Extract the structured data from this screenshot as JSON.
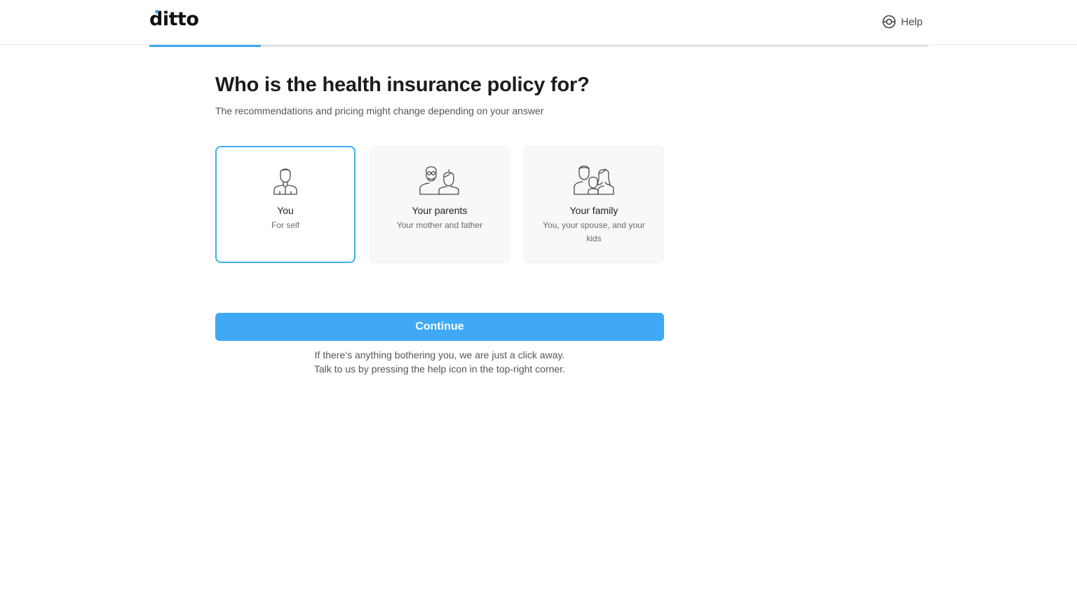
{
  "header": {
    "logo_text": "ditto",
    "help_label": "Help",
    "help_icon": "lifebuoy-icon"
  },
  "progress": {
    "fraction": 0.143
  },
  "main": {
    "title": "Who is the health insurance policy for?",
    "subtitle": "The recommendations and pricing might change depending on your answer",
    "options": [
      {
        "title": "You",
        "description": "For self",
        "icon": "single-person-icon",
        "selected": true
      },
      {
        "title": "Your parents",
        "description": "Your mother and father",
        "icon": "parents-icon",
        "selected": false
      },
      {
        "title": "Your family",
        "description": "You, your spouse, and your kids",
        "icon": "family-icon",
        "selected": false
      }
    ],
    "continue_label": "Continue",
    "note_line1": "If there’s anything bothering you, we are just a click away.",
    "note_line2": "Talk to us by pressing the help icon in the top-right corner."
  },
  "colors": {
    "accent": "#3fa9f5",
    "selected_border": "#3ab2ea",
    "card_background": "#f7f8fa"
  }
}
